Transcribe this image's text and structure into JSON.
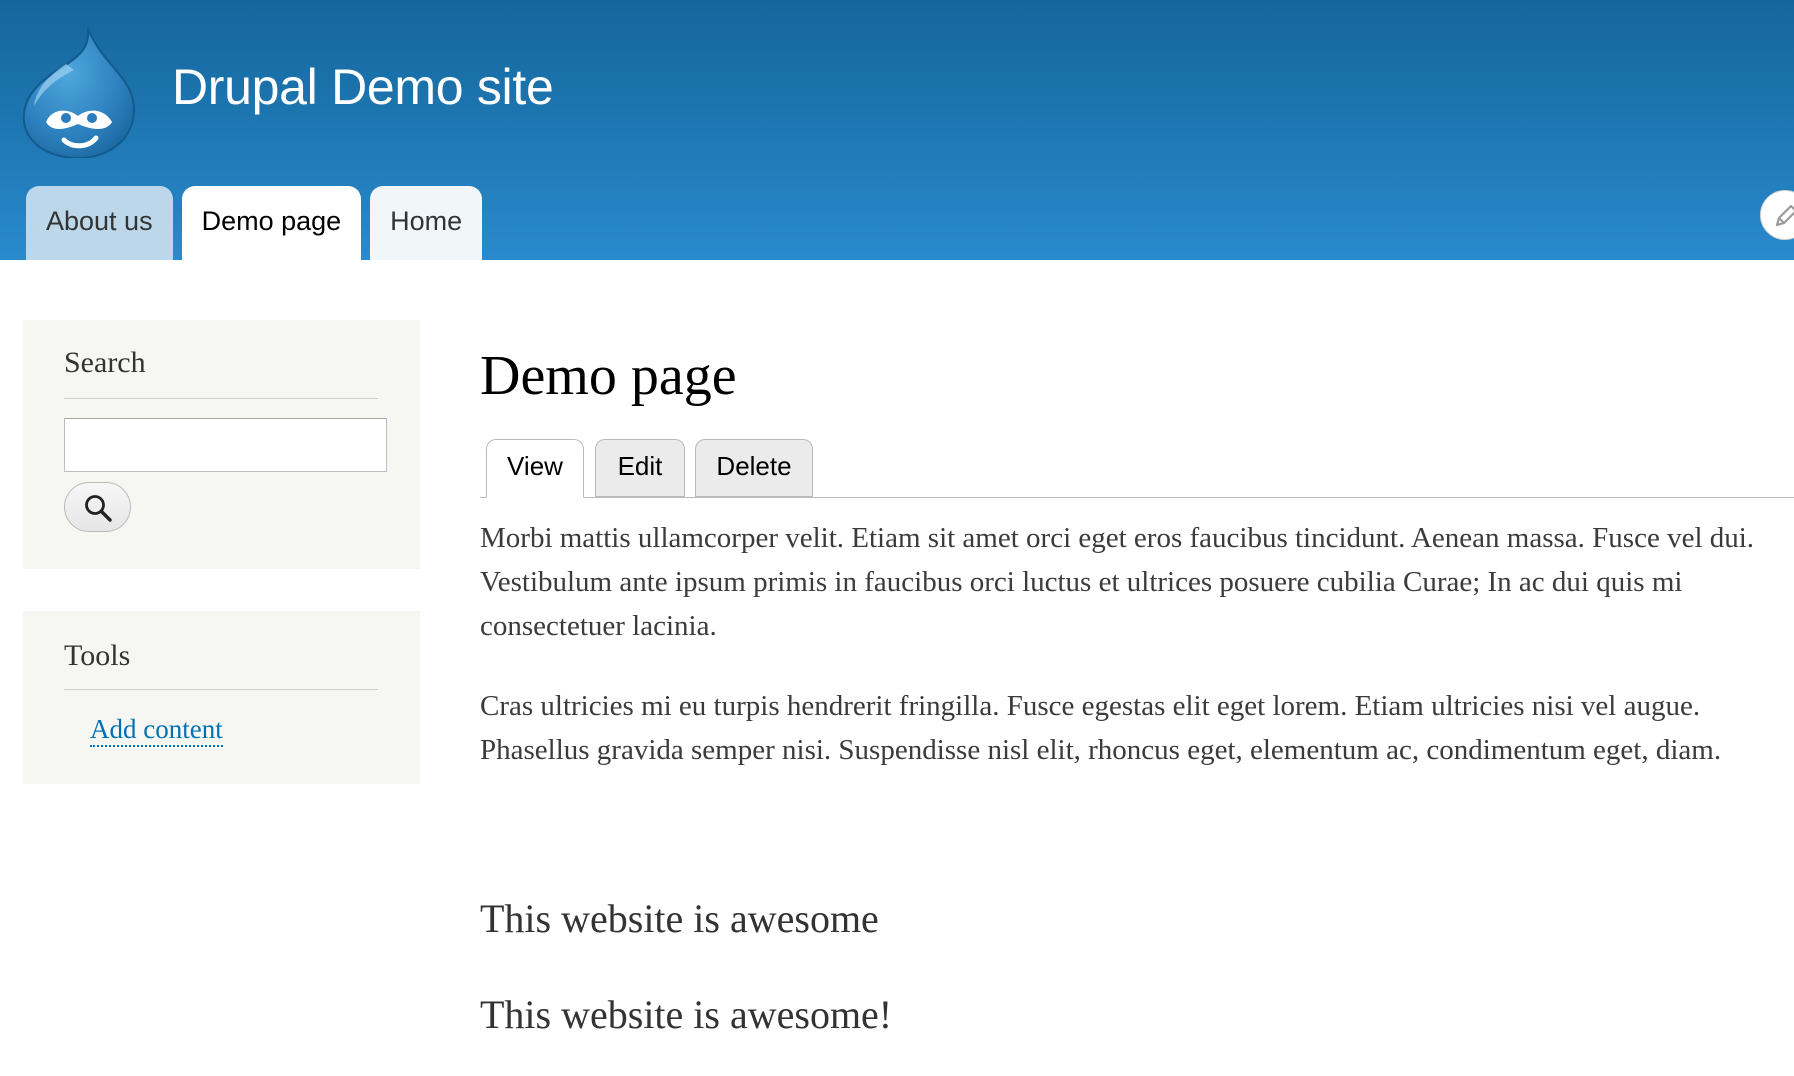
{
  "site": {
    "name": "Drupal Demo site"
  },
  "main_menu": {
    "items": [
      {
        "label": "About us"
      },
      {
        "label": "Demo page"
      },
      {
        "label": "Home"
      }
    ]
  },
  "sidebar": {
    "search_block": {
      "title": "Search",
      "input_value": "",
      "button_icon": "search-icon"
    },
    "tools_block": {
      "title": "Tools",
      "links": [
        {
          "label": "Add content"
        }
      ]
    }
  },
  "content": {
    "title": "Demo page",
    "tabs": [
      {
        "label": "View",
        "active": true
      },
      {
        "label": "Edit",
        "active": false
      },
      {
        "label": "Delete",
        "active": false
      }
    ],
    "paragraphs": [
      "Morbi mattis ullamcorper velit. Etiam sit amet orci eget eros faucibus tincidunt. Aenean massa. Fusce vel dui. Vestibulum ante ipsum primis in faucibus orci luctus et ultrices posuere cubilia Curae; In ac dui quis mi consectetuer lacinia.",
      "Cras ultricies mi eu turpis hendrerit fringilla. Fusce egestas elit eget lorem. Etiam ultricies nisi vel augue. Phasellus gravida semper nisi. Suspendisse nisl elit, rhoncus eget, elementum ac, condimentum eget, diam."
    ],
    "headings": [
      "This website is awesome",
      "This website is awesome!"
    ]
  },
  "icons": {
    "logo": "drupal-drop-logo",
    "contextual": "pencil-icon",
    "search": "search-icon"
  },
  "colors": {
    "header_top": "#15669c",
    "header_bottom": "#2a8acd",
    "link": "#0071b3",
    "sidebar_bg": "#f6f6f2"
  }
}
